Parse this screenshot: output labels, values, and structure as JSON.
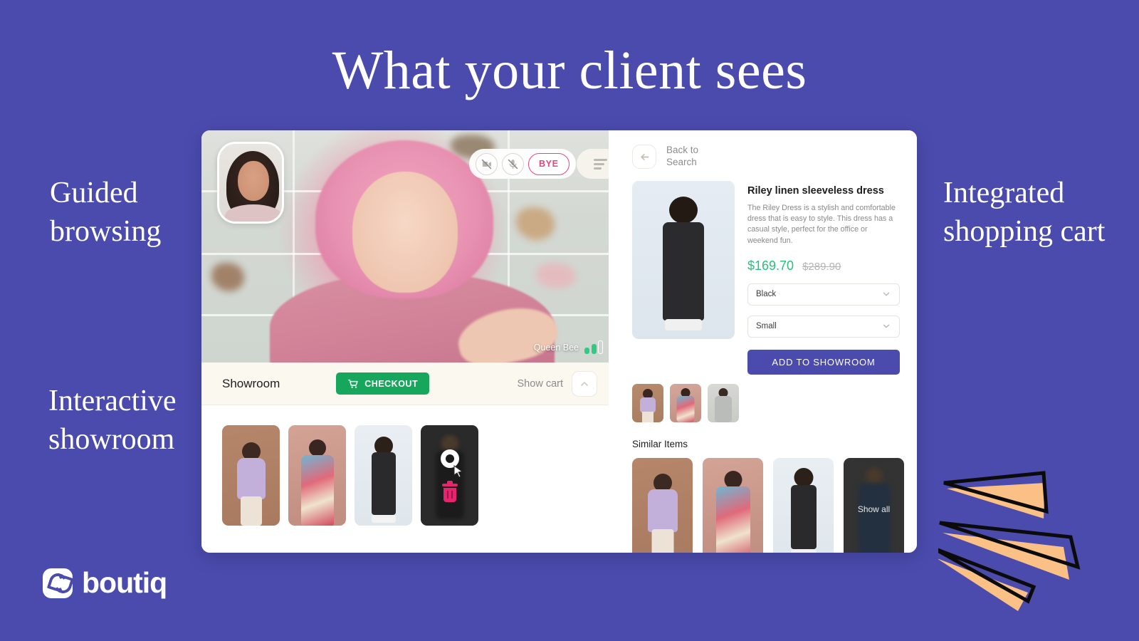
{
  "page": {
    "headline": "What your client sees",
    "background_color": "#4a4bad",
    "accent_purple": "#4a4bad",
    "accent_green": "#16a75c",
    "accent_pink": "#e8437e",
    "accent_peach": "#fbc086"
  },
  "captions": {
    "left_top": "Guided browsing",
    "left_bottom": "Interactive showroom",
    "right": "Integrated shopping cart"
  },
  "brand": {
    "name": "boutiq",
    "mark": "boutiq-logo-icon"
  },
  "video_call": {
    "participant_name": "Queen Bee",
    "signal_icon": "signal-bars-icon",
    "controls": [
      {
        "name": "camera-off-icon",
        "label": ""
      },
      {
        "name": "mic-off-icon",
        "label": ""
      },
      {
        "name": "end-call-button",
        "label": "BYE"
      }
    ],
    "menu_icon": "hamburger-menu-icon",
    "self_view": "self-view-thumbnail"
  },
  "showroom": {
    "title": "Showroom",
    "checkout_label": "CHECKOUT",
    "cart_icon": "shopping-cart-icon",
    "show_cart_label": "Show cart",
    "toggle_icon": "chevron-up-icon",
    "items": [
      {
        "name": "lilac-sweater-thumbnail",
        "selected": false
      },
      {
        "name": "floral-dress-thumbnail",
        "selected": false
      },
      {
        "name": "black-slip-dress-thumbnail",
        "selected": false
      },
      {
        "name": "hovered-item-thumbnail",
        "selected": true,
        "view_icon": "view-icon",
        "delete_icon": "trash-icon"
      }
    ]
  },
  "product_panel": {
    "back_label": "Back to Search",
    "back_icon": "arrow-left-icon",
    "title": "Riley linen sleeveless dress",
    "description": "The Riley Dress is a stylish and comfortable dress that is easy to style. This dress has a casual style, perfect for the office or weekend fun.",
    "price_current": "$169.70",
    "price_original": "$289.90",
    "options": [
      {
        "name": "color-select",
        "value": "Black",
        "icon": "chevron-down-icon"
      },
      {
        "name": "size-select",
        "value": "Small",
        "icon": "chevron-down-icon"
      }
    ],
    "add_button_label": "ADD TO SHOWROOM",
    "variant_thumbnails": [
      "lilac-sweater-variant",
      "floral-dress-variant",
      "grey-shirt-variant"
    ],
    "similar_items_title": "Similar Items",
    "similar_items": [
      {
        "name": "similar-lilac-sweater",
        "label": ""
      },
      {
        "name": "similar-floral-dress",
        "label": ""
      },
      {
        "name": "similar-black-dress",
        "label": ""
      },
      {
        "name": "similar-show-all",
        "label": "Show all"
      }
    ]
  }
}
